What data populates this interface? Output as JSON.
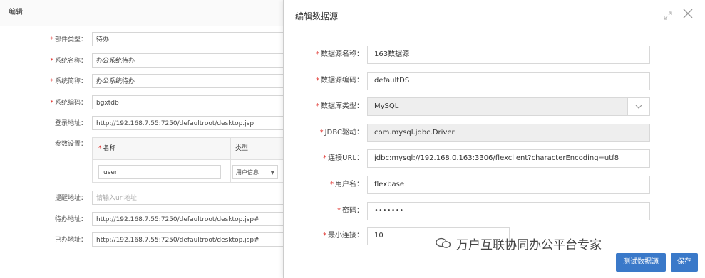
{
  "left": {
    "title": "编辑",
    "fields": [
      {
        "label": "部件类型：",
        "required": true,
        "value": "待办",
        "placeholder": ""
      },
      {
        "label": "系统名称：",
        "required": true,
        "value": "办公系统待办",
        "placeholder": ""
      },
      {
        "label": "系统简称：",
        "required": true,
        "value": "办公系统待办",
        "placeholder": ""
      },
      {
        "label": "系统编码：",
        "required": true,
        "value": "bgxtdb",
        "placeholder": ""
      },
      {
        "label": "登录地址：",
        "required": false,
        "value": "http://192.168.7.55:7250/defaultroot/desktop.jsp",
        "placeholder": ""
      }
    ],
    "params": {
      "label": "参数设置：",
      "col_name": "名称",
      "col_type": "类型",
      "row_name": "user",
      "row_type": "用户信息"
    },
    "fields2": [
      {
        "label": "提醒地址：",
        "value": "",
        "placeholder": "请输入url地址"
      },
      {
        "label": "待办地址：",
        "value": "http://192.168.7.55:7250/defaultroot/desktop.jsp#",
        "placeholder": ""
      },
      {
        "label": "已办地址：",
        "value": "http://192.168.7.55:7250/defaultroot/desktop.jsp#",
        "placeholder": ""
      }
    ]
  },
  "dialog": {
    "title": "编辑数据源",
    "fields": [
      {
        "label": "数据源名称：",
        "value": "163数据源"
      },
      {
        "label": "数据源编码：",
        "value": "defaultDS"
      },
      {
        "label": "数据库类型：",
        "value": "MySQL"
      },
      {
        "label": "JDBC驱动：",
        "value": "com.mysql.jdbc.Driver"
      },
      {
        "label": "连接URL：",
        "value": "jdbc:mysql://192.168.0.163:3306/flexclient?characterEncoding=utf8"
      },
      {
        "label": "用户名：",
        "value": "flexbase"
      },
      {
        "label": "密码：",
        "value": "•••••••"
      },
      {
        "label": "最小连接：",
        "value": "10"
      }
    ],
    "test_button": "测试数据源",
    "save_button": "保存"
  },
  "watermark": "万户互联协同办公平台专家",
  "colors": {
    "accent": "#3a79c9",
    "required": "#e0302b"
  }
}
